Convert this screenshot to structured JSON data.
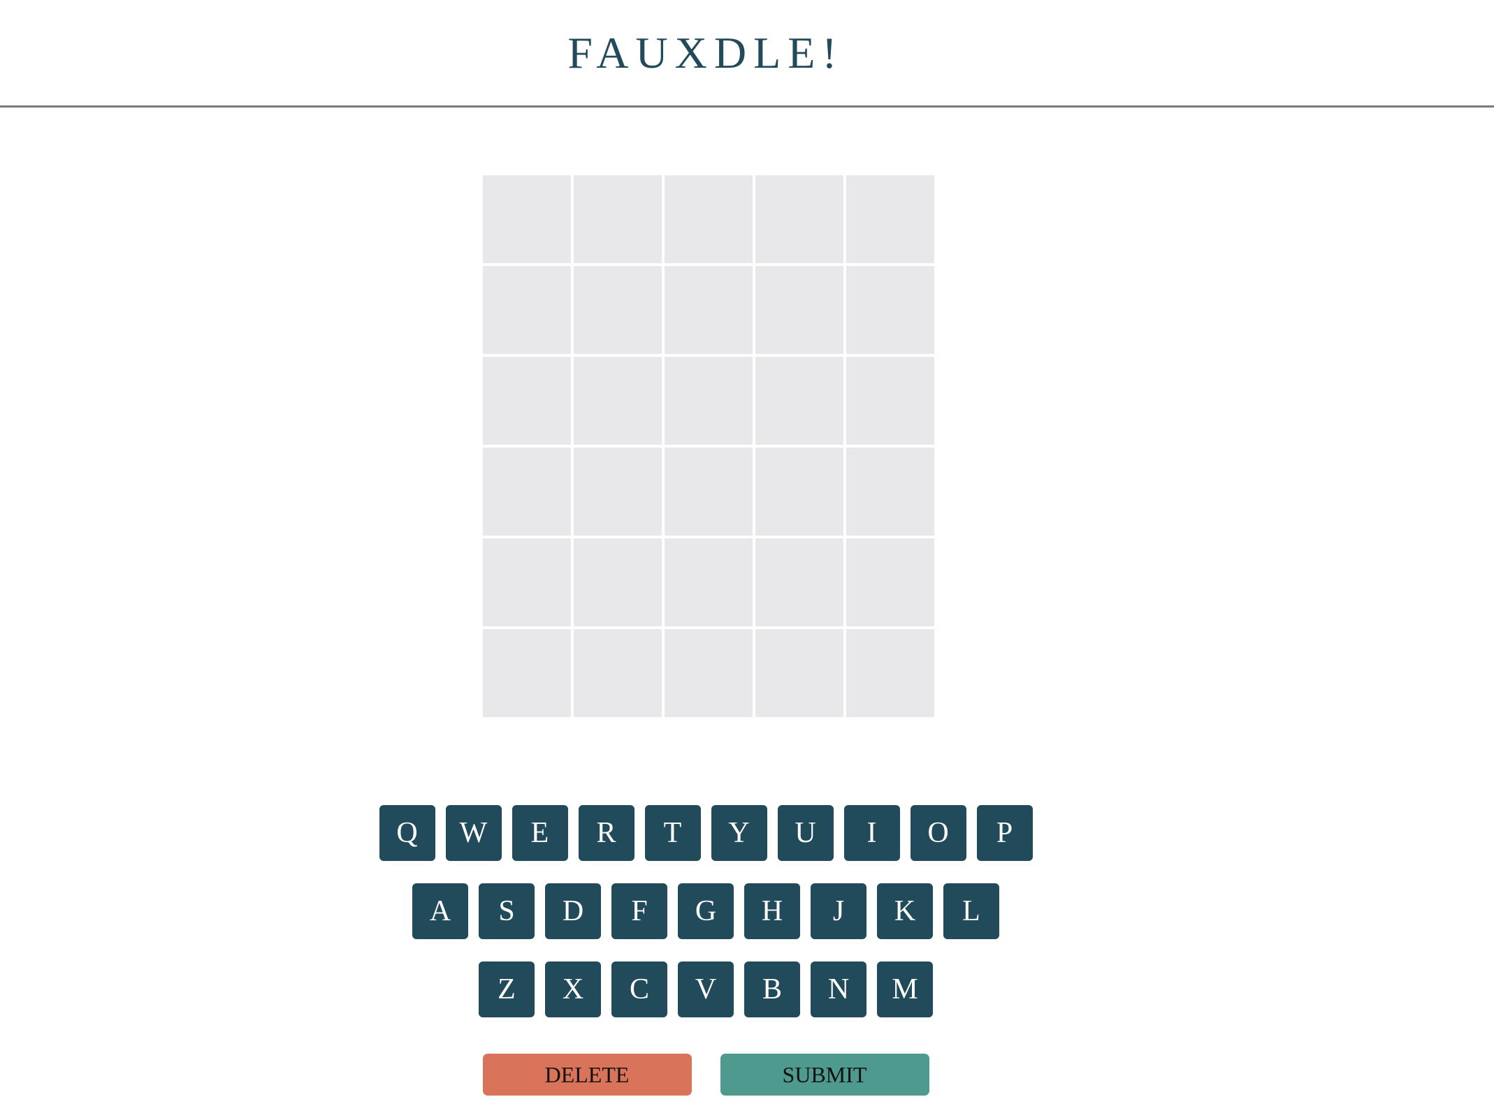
{
  "header": {
    "title": "FAUXDLE!"
  },
  "board": {
    "rows": 6,
    "cols": 5,
    "tiles": [
      [
        "",
        "",
        "",
        "",
        ""
      ],
      [
        "",
        "",
        "",
        "",
        ""
      ],
      [
        "",
        "",
        "",
        "",
        ""
      ],
      [
        "",
        "",
        "",
        "",
        ""
      ],
      [
        "",
        "",
        "",
        "",
        ""
      ],
      [
        "",
        "",
        "",
        "",
        ""
      ]
    ]
  },
  "keyboard": {
    "row1": [
      "Q",
      "W",
      "E",
      "R",
      "T",
      "Y",
      "U",
      "I",
      "O",
      "P"
    ],
    "row2": [
      "A",
      "S",
      "D",
      "F",
      "G",
      "H",
      "J",
      "K",
      "L"
    ],
    "row3": [
      "Z",
      "X",
      "C",
      "V",
      "B",
      "N",
      "M"
    ]
  },
  "actions": {
    "delete_label": "DELETE",
    "submit_label": "SUBMIT"
  },
  "colors": {
    "key": "#214a5b",
    "title": "#214a5b",
    "tile_empty": "#e8e8ea",
    "delete": "#d9745a",
    "submit": "#4f9a8e"
  }
}
